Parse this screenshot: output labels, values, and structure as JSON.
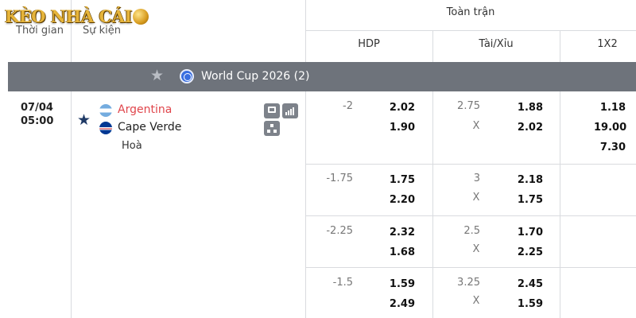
{
  "brand": {
    "logo_text": "KÈO NHÀ CÁI"
  },
  "header": {
    "time_col": "Thời gian",
    "event_col": "Sự kiện",
    "full_match": "Toàn trận",
    "markets": [
      "HDP",
      "Tài/Xỉu",
      "1X2"
    ]
  },
  "league": {
    "name": "World Cup 2026",
    "count": "(2)"
  },
  "match": {
    "date": "07/04",
    "time": "05:00",
    "home": "Argentina",
    "away": "Cape Verde",
    "draw": "Hoà"
  },
  "odds_rows": [
    {
      "hdp_line": "-2",
      "hdp_home": "2.02",
      "hdp_away": "1.90",
      "ou_line": "2.75",
      "ou_x": "X",
      "ou_over": "1.88",
      "ou_under": "2.02",
      "x12_home": "1.18",
      "x12_away": "19.00",
      "x12_draw": "7.30"
    },
    {
      "hdp_line": "-1.75",
      "hdp_home": "1.75",
      "hdp_away": "2.20",
      "ou_line": "3",
      "ou_x": "X",
      "ou_over": "2.18",
      "ou_under": "1.75"
    },
    {
      "hdp_line": "-2.25",
      "hdp_home": "2.32",
      "hdp_away": "1.68",
      "ou_line": "2.5",
      "ou_x": "X",
      "ou_over": "1.70",
      "ou_under": "2.25"
    },
    {
      "hdp_line": "-1.5",
      "hdp_home": "1.59",
      "hdp_away": "2.49",
      "ou_line": "3.25",
      "ou_x": "X",
      "ou_over": "2.45",
      "ou_under": "1.59"
    }
  ],
  "icons": {
    "league_star": "star-icon",
    "league_logo": "globe-icon",
    "favorite": "star-icon",
    "live_stream": "monitor-icon",
    "stats": "bar-chart-icon",
    "lineup": "network-icon"
  },
  "colors": {
    "league_bar": "#6e737b",
    "home_team": "#e0464c",
    "favorite_star": "#1f3a66"
  }
}
